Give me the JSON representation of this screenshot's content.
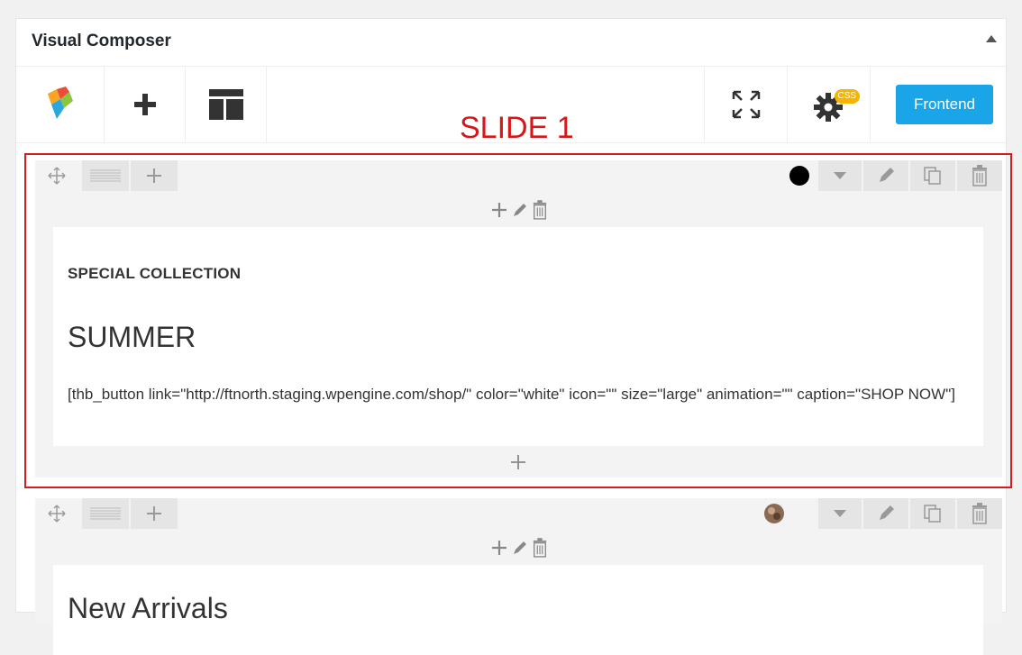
{
  "panel": {
    "title": "Visual Composer"
  },
  "toolbar": {
    "frontend_label": "Frontend",
    "css_badge": "CSS"
  },
  "annotation": {
    "slide_label": "SLIDE 1"
  },
  "rows": [
    {
      "subtitle": "SPECIAL COLLECTION",
      "heading": "SUMMER",
      "shortcode": "[thb_button link=\"http://ftnorth.staging.wpengine.com/shop/\" color=\"white\" icon=\"\" size=\"large\" animation=\"\" caption=\"SHOP NOW\"]"
    },
    {
      "heading": "New Arrivals"
    }
  ],
  "colors": {
    "accent": "#1aa5e8",
    "annotation": "#d21c22",
    "badge": "#f4b400"
  }
}
